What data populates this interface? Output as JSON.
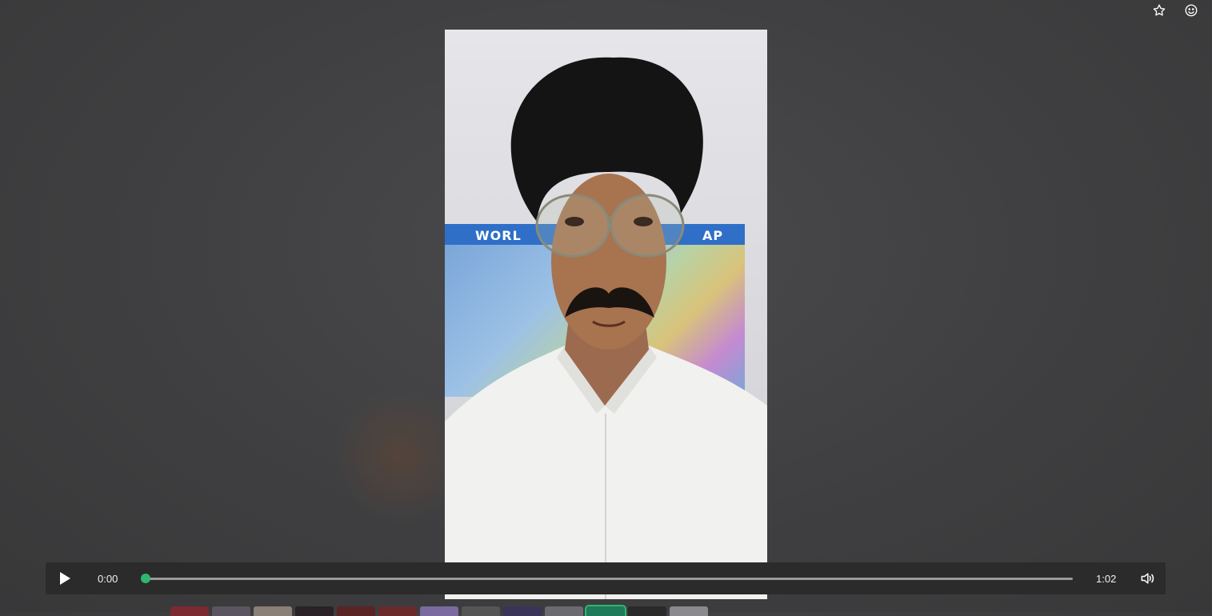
{
  "player": {
    "current_time": "0:00",
    "total_time": "1:02",
    "progress": 0.0,
    "accent_color": "#2eb86e"
  },
  "toolbar": {
    "favorite_icon": "star-icon",
    "reaction_icon": "smiley-icon"
  },
  "video": {
    "poster_text_left": "WORL",
    "poster_text_right": "AP"
  },
  "thumbnails": [
    {
      "color": "#7a2a30"
    },
    {
      "color": "#5a5560"
    },
    {
      "color": "#8a8078"
    },
    {
      "color": "#2a2226"
    },
    {
      "color": "#5a2424"
    },
    {
      "color": "#6a2a2a"
    },
    {
      "color": "#7a6aa0"
    },
    {
      "color": "#555555"
    },
    {
      "color": "#3a3458"
    },
    {
      "color": "#6a6a70"
    },
    {
      "color": "#1f7a5a"
    },
    {
      "color": "#2a2a2a"
    },
    {
      "color": "#8a8a8e"
    }
  ]
}
